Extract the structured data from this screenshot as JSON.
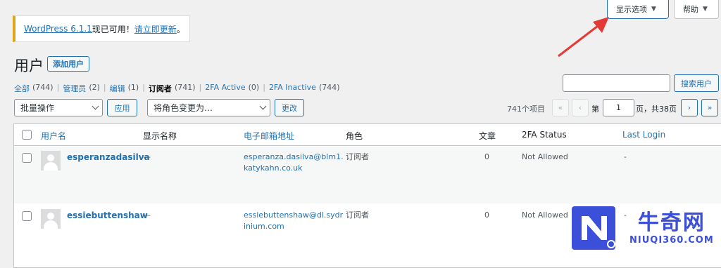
{
  "top_buttons": {
    "screen_options": "显示选项",
    "help": "帮助"
  },
  "notice": {
    "version_link": "WordPress 6.1.1",
    "text": "现已可用！",
    "update_link": "请立即更新",
    "end": "。"
  },
  "page": {
    "title": "用户",
    "add_button": "添加用户"
  },
  "filters": [
    {
      "label": "全部",
      "count": "(744)",
      "current": false
    },
    {
      "label": "管理员",
      "count": "(2)",
      "current": false
    },
    {
      "label": "编辑",
      "count": "(1)",
      "current": false
    },
    {
      "label": "订阅者",
      "count": "(741)",
      "current": true
    },
    {
      "label": "2FA Active",
      "count": "(0)",
      "current": false
    },
    {
      "label": "2FA Inactive",
      "count": "(744)",
      "current": false
    }
  ],
  "search": {
    "placeholder": "",
    "button": "搜索用户"
  },
  "bulk": {
    "selected": "批量操作",
    "apply": "应用"
  },
  "role_change": {
    "selected": "将角色变更为…",
    "button": "更改"
  },
  "pagination": {
    "items": "741个项目",
    "first": "«",
    "prev": "‹",
    "page_prefix": "第",
    "page": "1",
    "page_suffix": "页，共38页",
    "next": "›",
    "last": "»"
  },
  "columns": {
    "username": "用户名",
    "display_name": "显示名称",
    "email": "电子邮箱地址",
    "role": "角色",
    "posts": "文章",
    "twofa": "2FA Status",
    "last_login": "Last Login"
  },
  "rows": [
    {
      "username": "esperanzadasilva",
      "display_name": "—",
      "email_line1": "esperanza.dasilva@blm1.",
      "email_line2": "katykahn.co.uk",
      "role": "订阅者",
      "posts": "0",
      "twofa": "Not Allowed",
      "last_login": "-"
    },
    {
      "username": "essiebuttenshaw",
      "display_name": "—",
      "email_line1": "essiebuttenshaw@dl.sydr",
      "email_line2": "inium.com",
      "role": "订阅者",
      "posts": "0",
      "twofa": "Not Allowed",
      "last_login": "-"
    }
  ],
  "watermark": {
    "brand": "牛奇网",
    "domain": "NIUQI360.COM"
  },
  "colors": {
    "accent": "#2271b1",
    "arrow": "#e53935",
    "notice_border": "#dba617",
    "watermark": "#3b4fd8"
  }
}
